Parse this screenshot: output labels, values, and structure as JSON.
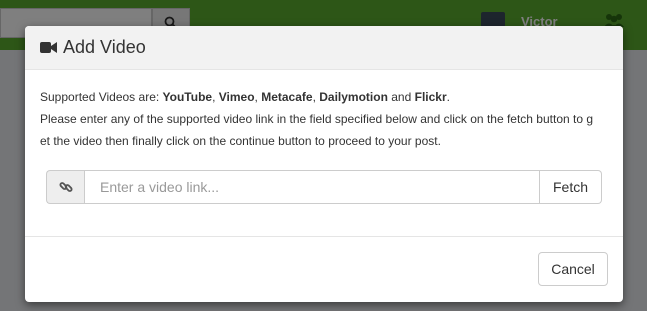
{
  "background": {
    "username": "Victor",
    "accent_color": "#5aac2f",
    "icons": [
      "search-icon",
      "group-icon"
    ]
  },
  "modal": {
    "header_icon": "video-camera-icon",
    "title": "Add Video",
    "intro": {
      "prefix": "Supported Videos are: ",
      "sites": [
        "YouTube",
        "Vimeo",
        "Metacafe",
        "Dailymotion",
        "Flickr"
      ],
      "sep1": ", ",
      "sep2": ", ",
      "sep3": ", ",
      "sep4": " and ",
      "suffix": ".",
      "line2": "Please enter any of the supported video link in the field specified below and click on the fetch button to g",
      "line3": "et the video then finally click on the continue button to proceed to your post."
    },
    "link_icon": "link-icon",
    "video_input": {
      "placeholder": "Enter a video link...",
      "value": ""
    },
    "fetch_label": "Fetch",
    "cancel_label": "Cancel"
  }
}
